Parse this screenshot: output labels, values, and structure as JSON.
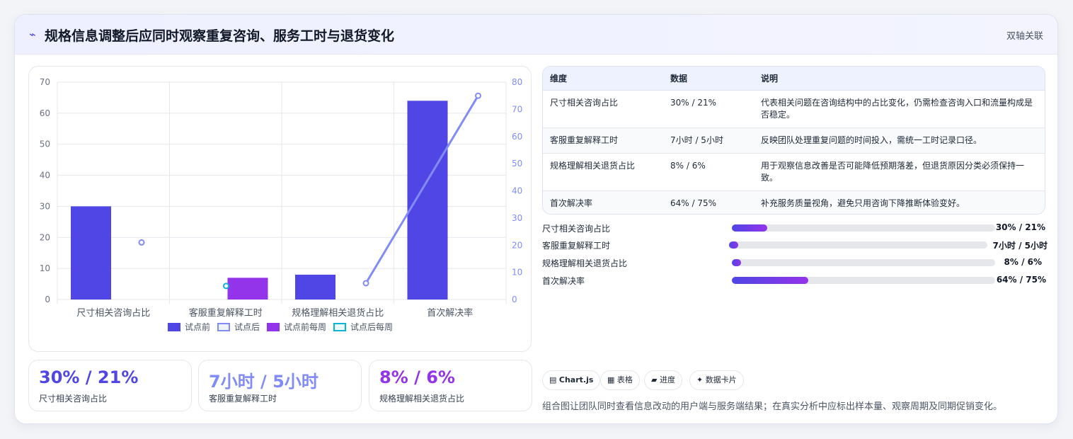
{
  "header": {
    "icon": "trend-icon",
    "title": "规格信息调整后应同时观察重复咨询、服务工时与退货变化",
    "tag": "双轴关联"
  },
  "colors": {
    "before": "#4f46e5",
    "after_line": "#818cf8",
    "before_weekly": "#9333ea",
    "after_weekly": "#06b6d4",
    "accent_3": "#7c3aed"
  },
  "chart_data": {
    "type": "bar",
    "categories": [
      "尺寸相关咨询占比",
      "客服重复解释工时",
      "规格理解相关退货占比",
      "首次解决率"
    ],
    "series": [
      {
        "name": "试点前",
        "type": "bar",
        "axis": "left",
        "values": [
          30,
          null,
          8,
          64
        ]
      },
      {
        "name": "试点后",
        "type": "line",
        "axis": "right",
        "values": [
          21,
          null,
          6,
          75
        ]
      },
      {
        "name": "试点前每周",
        "type": "bar",
        "axis": "left",
        "values": [
          null,
          7,
          null,
          null
        ]
      },
      {
        "name": "试点后每周",
        "type": "line",
        "axis": "right",
        "values": [
          null,
          5,
          null,
          null
        ]
      }
    ],
    "y_left": {
      "min": 0,
      "max": 70,
      "step": 10
    },
    "y_right": {
      "min": 0,
      "max": 80,
      "step": 10
    },
    "grid": true,
    "legend_position": "bottom"
  },
  "table": {
    "headers": [
      "维度",
      "数据",
      "说明"
    ],
    "rows": [
      [
        "尺寸相关咨询占比",
        "30% / 21%",
        "代表相关问题在咨询结构中的占比变化，仍需检查咨询入口和流量构成是否稳定。"
      ],
      [
        "客服重复解释工时",
        "7小时 / 5小时",
        "反映团队处理重复问题的时间投入，需统一工时记录口径。"
      ],
      [
        "规格理解相关退货占比",
        "8% / 6%",
        "用于观察信息改善是否可能降低预期落差，但退货原因分类必须保持一致。"
      ],
      [
        "首次解决率",
        "64% / 75%",
        "补充服务质量视角，避免只用咨询下降推断体验变好。"
      ]
    ]
  },
  "progress": [
    {
      "label": "尺寸相关咨询占比",
      "value": "30% / 21%",
      "fraction": 0.135
    },
    {
      "label": "客服重复解释工时",
      "value": "7小时 / 5小时",
      "fraction": 0.035
    },
    {
      "label": "规格理解相关退货占比",
      "value": "8% / 6%",
      "fraction": 0.035
    },
    {
      "label": "首次解决率",
      "value": "64% / 75%",
      "fraction": 0.29
    }
  ],
  "stats": [
    {
      "value": "30% / 21%",
      "label": "尺寸相关咨询占比",
      "color": "#4f46e5"
    },
    {
      "value": "7小时 / 5小时",
      "label": "客服重复解释工时",
      "color": "#818cf8"
    },
    {
      "value": "8% / 6%",
      "label": "规格理解相关退货占比",
      "color": "#9333ea"
    }
  ],
  "chips": [
    {
      "icon": "chart-icon",
      "glyph": "▤",
      "label": "Chart.js"
    },
    {
      "icon": "table-icon",
      "glyph": "▦",
      "label": "表格"
    },
    {
      "icon": "progress-icon",
      "glyph": "▰",
      "label": "进度"
    },
    {
      "icon": "sparkle-icon",
      "glyph": "✦",
      "label": "数据卡片"
    }
  ],
  "footer_note": "组合图让团队同时查看信息改动的用户端与服务端结果；在真实分析中应标出样本量、观察周期及同期促销变化。"
}
